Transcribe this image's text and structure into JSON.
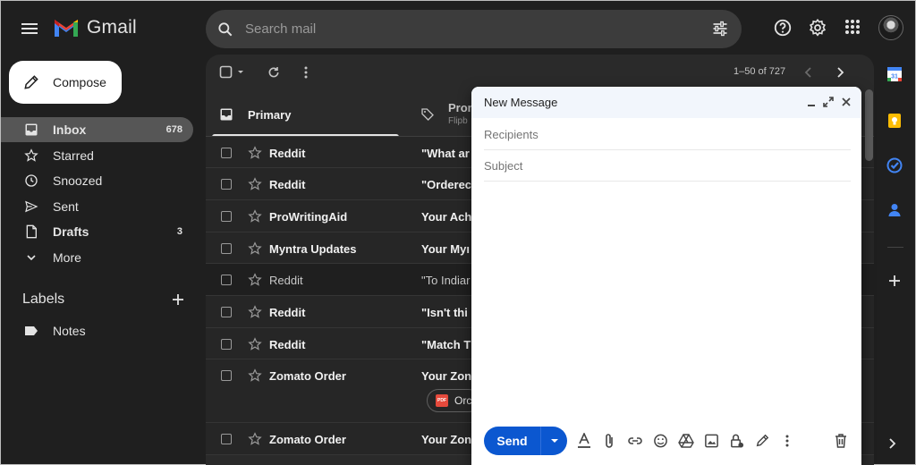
{
  "app": {
    "name": "Gmail",
    "brand_colors": [
      "#ea4335",
      "#fbbc04",
      "#34a853",
      "#4285f4"
    ]
  },
  "search": {
    "placeholder": "Search mail"
  },
  "compose": {
    "label": "Compose"
  },
  "sidebar": {
    "items": [
      {
        "label": "Inbox",
        "count": "678",
        "icon": "inbox-icon",
        "active": true
      },
      {
        "label": "Starred",
        "count": "",
        "icon": "star-icon"
      },
      {
        "label": "Snoozed",
        "count": "",
        "icon": "clock-icon"
      },
      {
        "label": "Sent",
        "count": "",
        "icon": "send-icon"
      },
      {
        "label": "Drafts",
        "count": "3",
        "icon": "file-icon"
      },
      {
        "label": "More",
        "count": "",
        "icon": "chevron-down-icon"
      }
    ],
    "labels_title": "Labels",
    "labels": [
      {
        "label": "Notes",
        "icon": "label-icon"
      }
    ]
  },
  "toolbar": {
    "range": "1–50 of 727"
  },
  "tabs": [
    {
      "label": "Primary",
      "icon": "inbox-icon",
      "active": true
    },
    {
      "label": "Prom",
      "sub": "Flipb",
      "icon": "tag-icon"
    }
  ],
  "emails": [
    {
      "sender": "Reddit",
      "subject": "\"What ar",
      "unread": true
    },
    {
      "sender": "Reddit",
      "subject": "\"Orderec",
      "unread": true
    },
    {
      "sender": "ProWritingAid",
      "subject": "Your Ach",
      "unread": true
    },
    {
      "sender": "Myntra Updates",
      "subject": "Your Myı",
      "unread": true
    },
    {
      "sender": "Reddit",
      "subject": "\"To Indiar",
      "unread": false
    },
    {
      "sender": "Reddit",
      "subject": "\"Isn't thi",
      "unread": true
    },
    {
      "sender": "Reddit",
      "subject": "\"Match T",
      "unread": true
    },
    {
      "sender": "Zomato Order",
      "subject": "Your Zon",
      "unread": true,
      "attachment": "Orc"
    },
    {
      "sender": "Zomato Order",
      "subject": "Your Zon",
      "unread": true
    }
  ],
  "new_message": {
    "title": "New Message",
    "recipients_placeholder": "Recipients",
    "subject_placeholder": "Subject",
    "send_label": "Send",
    "accent": "#0b57d0"
  }
}
